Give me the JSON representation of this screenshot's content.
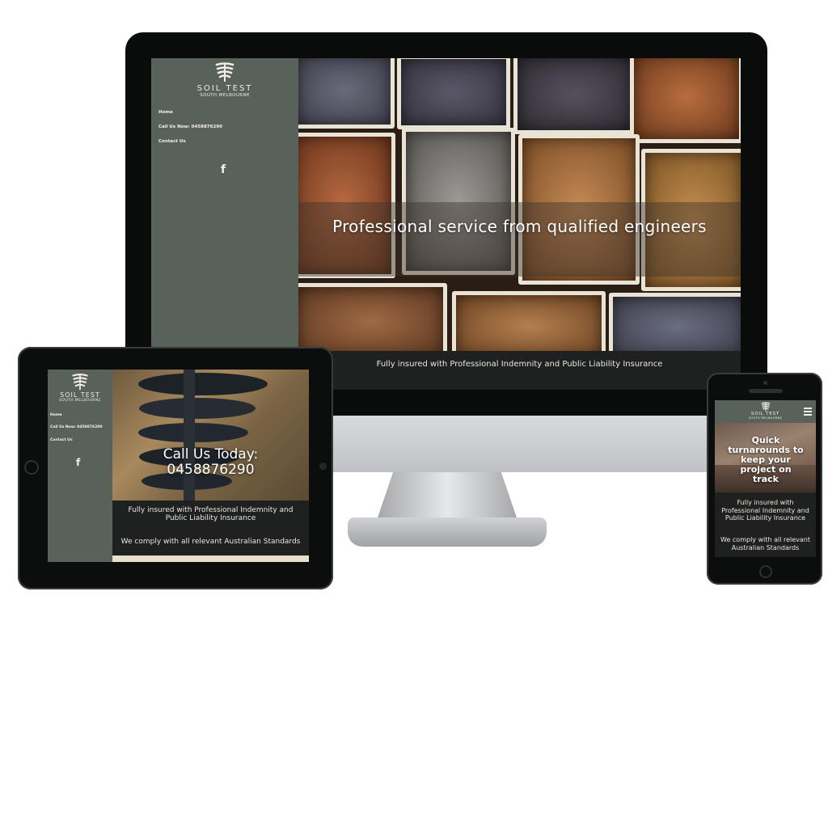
{
  "brand": {
    "name": "SOIL TEST",
    "subtitle": "SOUTH MELBOURNE"
  },
  "nav": {
    "home": "Home",
    "call": "Call Us Now: 0458876290",
    "contact": "Contact Us",
    "facebook_icon": "facebook-icon",
    "menu_icon": "hamburger-icon"
  },
  "desktop": {
    "hero_heading": "Professional service from qualified engineers",
    "band_text": "Fully insured with Professional Indemnity and Public Liability Insurance"
  },
  "tablet": {
    "hero_heading_line1": "Call Us Today:",
    "hero_heading_line2": "0458876290",
    "band_text_1": "Fully insured with Professional Indemnity and Public Liability Insurance",
    "band_text_2": "We comply with all relevant Australian Standards"
  },
  "phone": {
    "hero_heading": "Quick turnarounds to keep your project on track",
    "band_text_1": "Fully insured with Professional Indemnity and Public Liability Insurance",
    "band_text_2": "We comply with all relevant Australian Standards"
  },
  "colors": {
    "sidebar": "#58625b",
    "band": "#1f2020",
    "device_frame": "#0a0b0b"
  }
}
